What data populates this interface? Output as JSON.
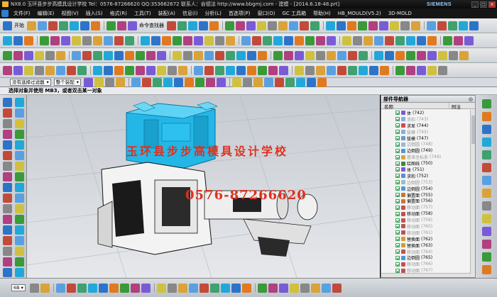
{
  "window": {
    "title": "NX8.0  玉环县步步高模具设计学校  Tel：0576-87266620 QQ:353662672  联系人：俞德法  http://www.bbgmj.com - 建模 - [2014.6.18-48.prt]",
    "brand": "SIEMENS"
  },
  "menu": [
    "文件(F)",
    "编辑(E)",
    "视图(V)",
    "插入(S)",
    "格式(R)",
    "工具(T)",
    "装配(A)",
    "信息(I)",
    "分析(L)",
    "首选项(P)",
    "窗口(O)",
    "GC 工具箱",
    "帮助(H)",
    "HB_MOULD(V5.2)",
    "3D-MOLD"
  ],
  "toolbar": {
    "start_label": "开始",
    "command_finder_label": "命令查找器"
  },
  "selection": {
    "filter_value": "没有选择过滤器",
    "scope_value": "整个装配"
  },
  "cue_text": "选择对象并使用 MB3，或者双击某一对象",
  "watermark": {
    "line1": "玉环县步步高模具设计学校",
    "line2": "0576-87266620"
  },
  "navigator": {
    "title": "部件导航器",
    "close_glyph": "◎",
    "col_name": "名称",
    "col_note": "附注",
    "rows": [
      {
        "name": "体",
        "id": "(742)",
        "dim": false,
        "color": "#7a5bd6"
      },
      {
        "name": "求和",
        "id": "(743)",
        "dim": true,
        "color": "#7fb0e0"
      },
      {
        "name": "求差",
        "id": "(744)",
        "dim": false,
        "color": "#d24a4a"
      },
      {
        "name": "拔模",
        "id": "(745)",
        "dim": true,
        "color": "#8ab0d0"
      },
      {
        "name": "拔模",
        "id": "(747)",
        "dim": false,
        "color": "#6a9acb"
      },
      {
        "name": "边倒圆",
        "id": "(748)",
        "dim": true,
        "color": "#9bc"
      },
      {
        "name": "边倒圆",
        "id": "(749)",
        "dim": false,
        "color": "#4a9ad6"
      },
      {
        "name": "基准坐标系",
        "id": "(749)",
        "dim": true,
        "color": "#d9a33a"
      },
      {
        "name": "绘图线",
        "id": "(750)",
        "dim": false,
        "color": "#3a8a3a"
      },
      {
        "name": "体",
        "id": "(751)",
        "dim": false,
        "color": "#7a5bd6"
      },
      {
        "name": "求和",
        "id": "(752)",
        "dim": false,
        "color": "#5a8fd0"
      },
      {
        "name": "边倒圆",
        "id": "(753)",
        "dim": true,
        "color": "#9bc"
      },
      {
        "name": "边倒圆",
        "id": "(754)",
        "dim": false,
        "color": "#4a9ad6"
      },
      {
        "name": "偏置面",
        "id": "(755)",
        "dim": false,
        "color": "#c47a2c"
      },
      {
        "name": "偏置面",
        "id": "(756)",
        "dim": false,
        "color": "#c47a2c"
      },
      {
        "name": "移动面",
        "id": "(757)",
        "dim": true,
        "color": "#b55"
      },
      {
        "name": "移动面",
        "id": "(758)",
        "dim": false,
        "color": "#c05050"
      },
      {
        "name": "移动面",
        "id": "(759)",
        "dim": true,
        "color": "#b55"
      },
      {
        "name": "移动面",
        "id": "(760)",
        "dim": true,
        "color": "#b55"
      },
      {
        "name": "移动面",
        "id": "(761)",
        "dim": true,
        "color": "#b55"
      },
      {
        "name": "替换面",
        "id": "(762)",
        "dim": false,
        "color": "#d0a030"
      },
      {
        "name": "替换面",
        "id": "(763)",
        "dim": false,
        "color": "#d0a030"
      },
      {
        "name": "移动面",
        "id": "(764)",
        "dim": true,
        "color": "#b55"
      },
      {
        "name": "边倒圆",
        "id": "(765)",
        "dim": false,
        "color": "#4a9ad6"
      },
      {
        "name": "移动面",
        "id": "(766)",
        "dim": true,
        "color": "#b55"
      },
      {
        "name": "移动面",
        "id": "(767)",
        "dim": true,
        "color": "#b55"
      }
    ]
  },
  "status": {
    "zoom_value": "6B"
  },
  "colors": {
    "part_cyan": "#22b7e6",
    "watermark_red": "#e0301e",
    "viewport_top": "#c5cad1"
  }
}
